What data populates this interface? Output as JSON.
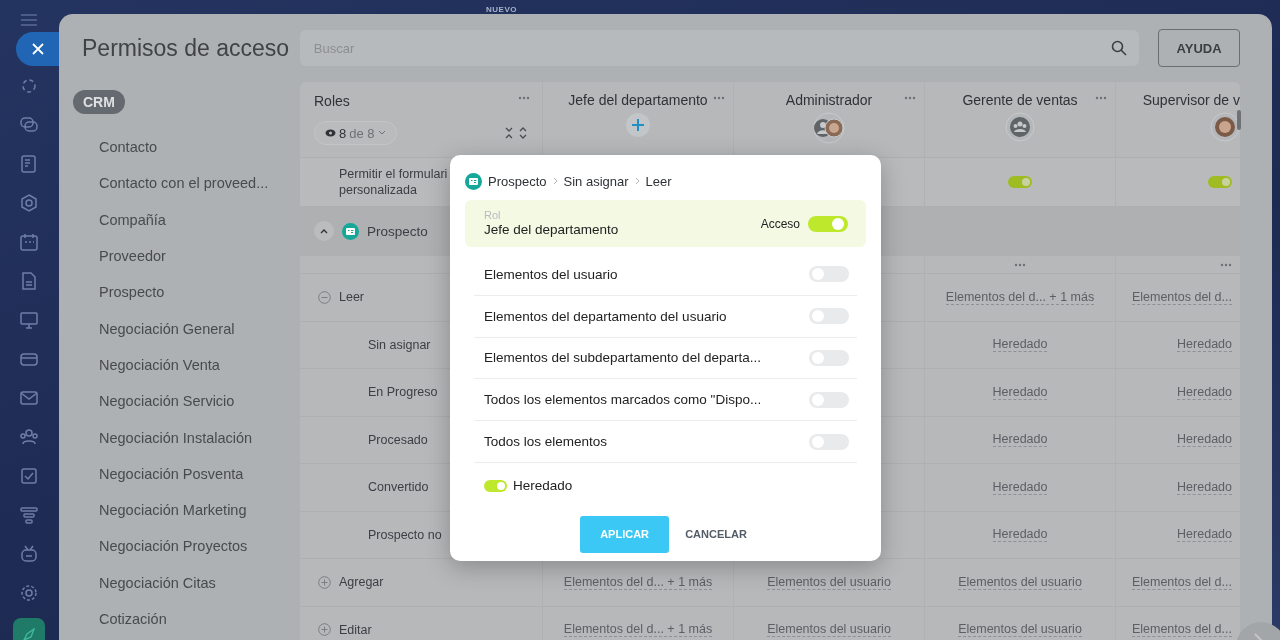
{
  "top_label": "NUEVO",
  "title": "Permisos de acceso",
  "search": {
    "placeholder": "Buscar"
  },
  "help_button": "AYUDA",
  "sidebar": {
    "section": "CRM",
    "items": [
      {
        "label": "Contacto"
      },
      {
        "label": "Contacto con el proveed..."
      },
      {
        "label": "Compañía"
      },
      {
        "label": "Proveedor"
      },
      {
        "label": "Prospecto"
      },
      {
        "label": "Negociación General"
      },
      {
        "label": "Negociación Venta"
      },
      {
        "label": "Negociación Servicio"
      },
      {
        "label": "Negociación Instalación"
      },
      {
        "label": "Negociación Posventa"
      },
      {
        "label": "Negociación Marketing"
      },
      {
        "label": "Negociación Proyectos"
      },
      {
        "label": "Negociación Citas"
      },
      {
        "label": "Cotización"
      }
    ]
  },
  "table": {
    "roles_label": "Roles",
    "filter": {
      "count": "8",
      "total": "de 8"
    },
    "columns": [
      {
        "name": "Jefe del departamento",
        "kind": "add"
      },
      {
        "name": "Administrador",
        "kind": "pair"
      },
      {
        "name": "Gerente de ventas",
        "kind": "group"
      },
      {
        "name": "Supervisor de v",
        "kind": "person"
      }
    ],
    "rows": [
      {
        "kind": "toggle",
        "label": "Permitir el formulari",
        "label_2": "personalizada",
        "cells": [
          {
            "on": true
          },
          {
            "on": true
          }
        ]
      },
      {
        "kind": "section",
        "label": "Prospecto",
        "expanded": true
      },
      {
        "kind": "menu",
        "cells": [
          {
            "kind": "menu"
          },
          {
            "kind": "menu"
          }
        ]
      },
      {
        "kind": "action",
        "label": "Leer",
        "expanded": true,
        "cells": [
          "Elementos del d... + 1 más",
          "Elementos del d..."
        ]
      },
      {
        "kind": "stage",
        "label": "Sin asignar",
        "cells": [
          "Heredado",
          "Heredado"
        ]
      },
      {
        "kind": "stage",
        "label": "En Progreso",
        "cells": [
          "Heredado",
          "Heredado"
        ]
      },
      {
        "kind": "stage",
        "label": "Procesado",
        "cells": [
          "Heredado",
          "Heredado"
        ]
      },
      {
        "kind": "stage",
        "label": "Convertido",
        "cells": [
          "Heredado",
          "Heredado"
        ]
      },
      {
        "kind": "stage",
        "label": "Prospecto no",
        "cells": [
          "Heredado",
          "Heredado"
        ]
      },
      {
        "kind": "action",
        "label": "Agregar",
        "expanded": false,
        "cells": [
          "Elementos del d... + 1 más",
          "Elementos del usuario",
          "Elementos del usuario",
          "Elementos del d..."
        ]
      },
      {
        "kind": "action",
        "label": "Editar",
        "expanded": false,
        "cells": [
          "Elementos del d... + 1 más",
          "Elementos del usuario",
          "Elementos del usuario",
          "Elementos del d..."
        ]
      }
    ]
  },
  "dialog": {
    "breadcrumb": [
      "Prospecto",
      "Sin asignar",
      "Leer"
    ],
    "role_caption": "Rol",
    "role": "Jefe del departamento",
    "access_label": "Acceso",
    "access_on": true,
    "options": [
      {
        "label": "Elementos del usuario",
        "on": false
      },
      {
        "label": "Elementos del departamento del usuario",
        "on": false
      },
      {
        "label": "Elementos del subdepartamento del departa...",
        "on": false
      },
      {
        "label": "Todos los elementos marcados como \"Dispo...",
        "on": false
      },
      {
        "label": "Todos los elementos",
        "on": false
      }
    ],
    "inherited": {
      "label": "Heredado",
      "on": true
    },
    "buttons": [
      "APLICAR",
      "CANCELAR"
    ]
  }
}
